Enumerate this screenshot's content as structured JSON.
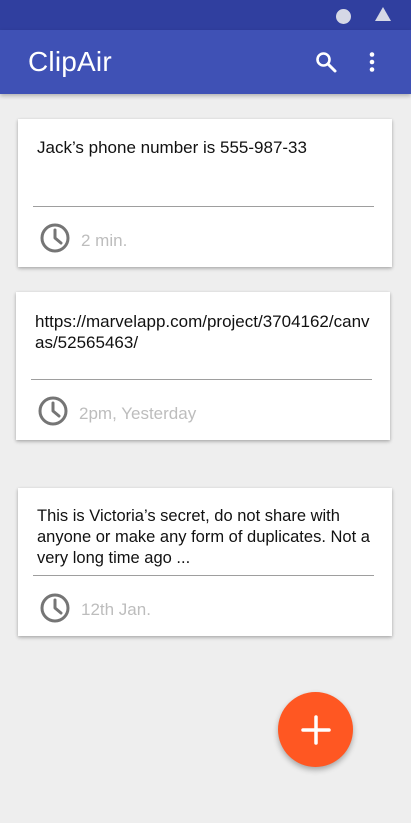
{
  "app": {
    "title": "ClipAir",
    "primary_color": "#3f51b5",
    "status_bar_color": "#303f9f",
    "accent_color": "#ff5722"
  },
  "toolbar": {
    "search_icon": "search-icon",
    "more_icon": "more-vert-icon"
  },
  "clips": [
    {
      "text": "Jack’s phone number is 555-987-33",
      "time": "2 min."
    },
    {
      "text": "https://marvelapp.com/project/3704162/canvas/52565463/",
      "time": "2pm, Yesterday"
    },
    {
      "text": "This is Victoria’s secret, do not share with anyone or make any form of duplicates. Not a very long time ago ...",
      "time": "12th Jan."
    }
  ],
  "fab": {
    "icon": "add-icon"
  }
}
